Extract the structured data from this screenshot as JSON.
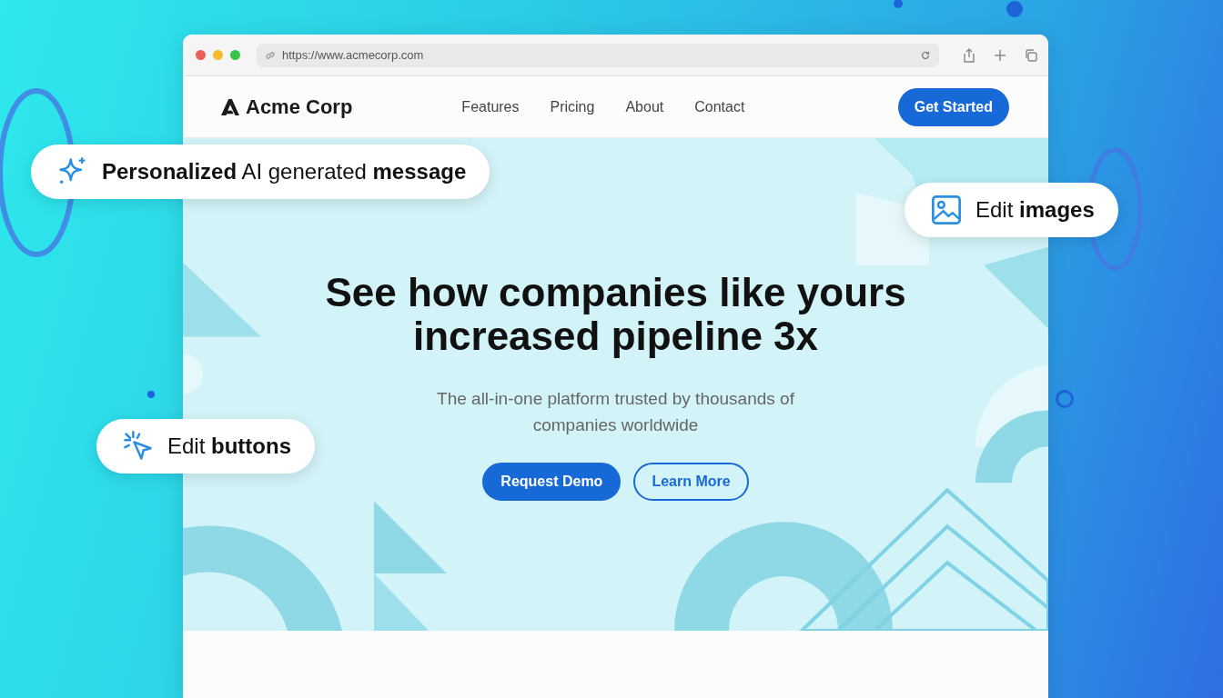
{
  "browser": {
    "url": "https://www.acmecorp.com"
  },
  "site": {
    "logo": "Acme Corp",
    "nav": [
      {
        "label": "Features"
      },
      {
        "label": "Pricing"
      },
      {
        "label": "About"
      },
      {
        "label": "Contact"
      }
    ],
    "cta": "Get Started"
  },
  "hero": {
    "title": "See how companies like yours increased pipeline 3x",
    "subtitle": "The all-in-one platform trusted by thousands of companies worldwide",
    "buttons": [
      {
        "label": "Request Demo",
        "kind": "primary"
      },
      {
        "label": "Learn More",
        "kind": "outline"
      }
    ]
  },
  "callouts": [
    {
      "kind": "sparkle",
      "text": "**Personalized** AI generated **message**"
    },
    {
      "kind": "image",
      "text": "Edit **images**"
    },
    {
      "kind": "cursor",
      "text": "Edit **buttons**"
    }
  ]
}
